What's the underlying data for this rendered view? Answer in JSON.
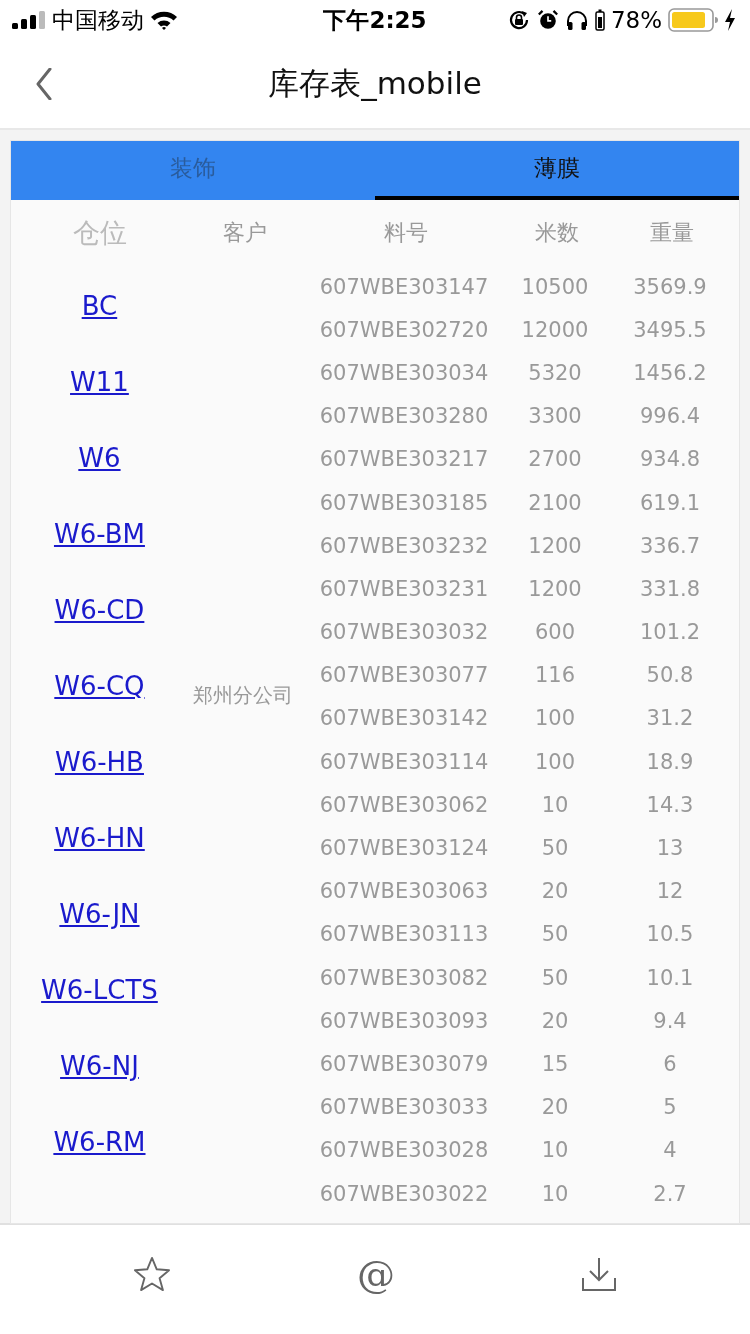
{
  "status_bar": {
    "carrier": "中国移动",
    "time": "下午2:25",
    "battery": "78%"
  },
  "nav": {
    "title": "库存表_mobile"
  },
  "tabs": [
    {
      "label": "装饰",
      "selected": false
    },
    {
      "label": "薄膜",
      "selected": true
    }
  ],
  "location_column": {
    "header": "仓位",
    "links": [
      "BC",
      "W11",
      "W6",
      "W6-BM",
      "W6-CD",
      "W6-CQ",
      "W6-HB",
      "W6-HN",
      "W6-JN",
      "W6-LCTS",
      "W6-NJ",
      "W6-RM"
    ]
  },
  "customer_column": {
    "header": "客户",
    "value": "郑州分公司"
  },
  "table": {
    "columns": [
      "料号",
      "米数",
      "重量"
    ],
    "rows": [
      [
        "607WBE303147",
        "10500",
        "3569.9"
      ],
      [
        "607WBE302720",
        "12000",
        "3495.5"
      ],
      [
        "607WBE303034",
        "5320",
        "1456.2"
      ],
      [
        "607WBE303280",
        "3300",
        "996.4"
      ],
      [
        "607WBE303217",
        "2700",
        "934.8"
      ],
      [
        "607WBE303185",
        "2100",
        "619.1"
      ],
      [
        "607WBE303232",
        "1200",
        "336.7"
      ],
      [
        "607WBE303231",
        "1200",
        "331.8"
      ],
      [
        "607WBE303032",
        "600",
        "101.2"
      ],
      [
        "607WBE303077",
        "116",
        "50.8"
      ],
      [
        "607WBE303142",
        "100",
        "31.2"
      ],
      [
        "607WBE303114",
        "100",
        "18.9"
      ],
      [
        "607WBE303062",
        "10",
        "14.3"
      ],
      [
        "607WBE303124",
        "50",
        "13"
      ],
      [
        "607WBE303063",
        "20",
        "12"
      ],
      [
        "607WBE303113",
        "50",
        "10.5"
      ],
      [
        "607WBE303082",
        "50",
        "10.1"
      ],
      [
        "607WBE303093",
        "20",
        "9.4"
      ],
      [
        "607WBE303079",
        "15",
        "6"
      ],
      [
        "607WBE303033",
        "20",
        "5"
      ],
      [
        "607WBE303028",
        "10",
        "4"
      ],
      [
        "607WBE303022",
        "10",
        "2.7"
      ]
    ]
  },
  "toolbar": [
    {
      "kind": "star"
    },
    {
      "kind": "at",
      "glyph": "@"
    },
    {
      "kind": "download"
    }
  ]
}
